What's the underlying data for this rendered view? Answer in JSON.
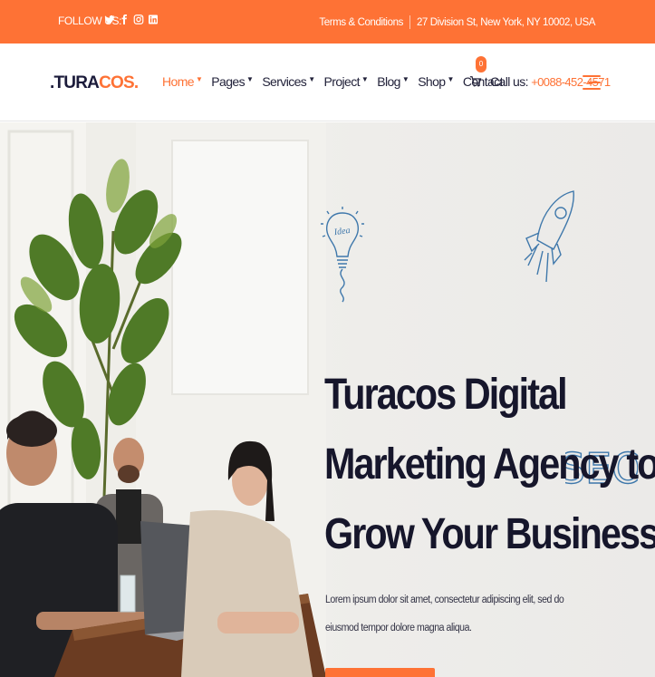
{
  "topbar": {
    "follow_label": "FOLLOW US:",
    "socials": [
      "twitter-icon",
      "facebook-icon",
      "instagram-icon",
      "linkedin-icon"
    ],
    "links": [
      "Terms & Conditions",
      "27 Division St, New York, NY 10002, USA"
    ]
  },
  "header": {
    "logo_prefix": ".TURA",
    "logo_suffix": "COS.",
    "nav": [
      {
        "label": "Home",
        "active": true
      },
      {
        "label": "Pages"
      },
      {
        "label": "Services"
      },
      {
        "label": "Project"
      },
      {
        "label": "Blog"
      },
      {
        "label": "Shop"
      },
      {
        "label": "Contact"
      }
    ],
    "cart_count": "0",
    "call_label": "Call us:",
    "call_number": "+0088-452-4571"
  },
  "hero": {
    "title_lines": [
      "Turacos Digital",
      "Marketing Agency to",
      "Grow Your Business"
    ],
    "description": "Lorem ipsum dolor sit amet, consectetur adipiscing elit, sed do eiusmod tempor dolore magna aliqua.",
    "idea_label": "Idea",
    "seo_label": "SEO"
  },
  "colors": {
    "accent": "#fe7235",
    "dark": "#16162b"
  }
}
